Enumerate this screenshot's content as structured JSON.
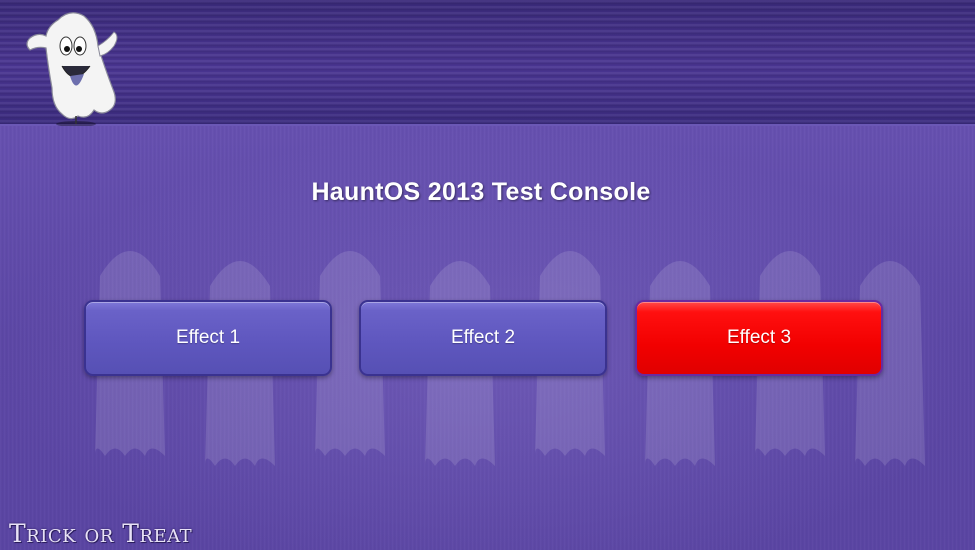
{
  "header": {
    "logo_icon": "ghost-icon"
  },
  "main": {
    "title": "HauntOS 2013 Test Console",
    "effects": [
      {
        "label": "Effect 1",
        "state": "inactive",
        "color": "#5f57bf"
      },
      {
        "label": "Effect 2",
        "state": "inactive",
        "color": "#5f57bf"
      },
      {
        "label": "Effect 3",
        "state": "active",
        "color": "#f20000"
      }
    ],
    "background_icon": "ghost-pattern-icon"
  },
  "footer": {
    "brand_text": "Trick or Treat"
  },
  "colors": {
    "header_bg": "#43318a",
    "main_bg": "#5c47a6",
    "button_normal": "#5f57bf",
    "button_active": "#f20000"
  }
}
